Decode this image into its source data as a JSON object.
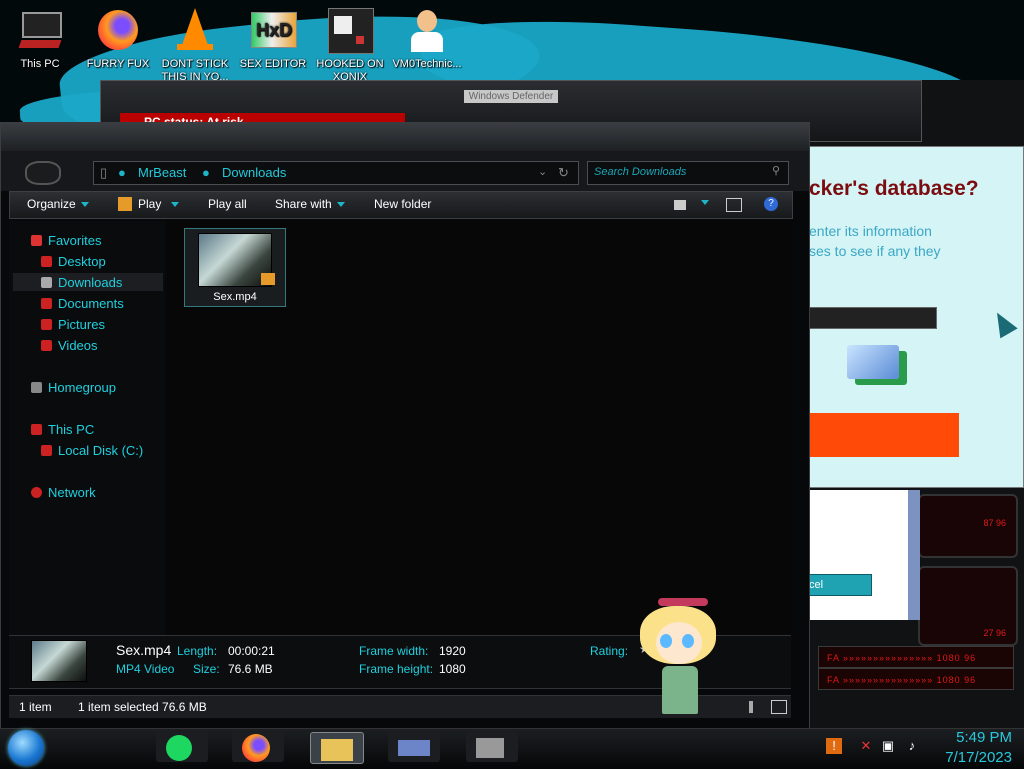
{
  "desktop": {
    "icons": [
      {
        "label": "This PC",
        "icon": "computer-icon"
      },
      {
        "label": "FURRY FUX",
        "icon": "firefox-icon"
      },
      {
        "label": "DONT STICK THIS IN YO...",
        "icon": "vlc-cone-icon"
      },
      {
        "label": "SEX EDITOR",
        "icon": "hxd-editor-icon"
      },
      {
        "label": "HOOKED ON XONIX",
        "icon": "game-icon"
      },
      {
        "label": "VM0Technic...",
        "icon": "doctor-icon"
      }
    ]
  },
  "background_windows": {
    "defender_title": "Windows Defender",
    "defender_status": "PC status: At risk",
    "scam_heading": "cker's database?",
    "scam_line1": "enter its information",
    "scam_line2": "ses to see if any they",
    "scam_cancel": "cel"
  },
  "hud": {
    "bar1": "FA »»»»»»»»»»»»»»» 1080 96",
    "bar2": "FA »»»»»»»»»»»»»»» 1080 96",
    "panel_val1": "87 96",
    "panel_val2": "27 96"
  },
  "explorer": {
    "breadcrumb": [
      "MrBeast",
      "Downloads"
    ],
    "search_placeholder": "Search Downloads",
    "toolbar": {
      "organize": "Organize",
      "play": "Play",
      "play_all": "Play all",
      "share_with": "Share with",
      "new_folder": "New folder"
    },
    "sidebar": {
      "favorites": "Favorites",
      "desktop": "Desktop",
      "downloads": "Downloads",
      "documents": "Documents",
      "pictures": "Pictures",
      "videos": "Videos",
      "homegroup": "Homegroup",
      "this_pc": "This PC",
      "local_disk": "Local Disk (C:)",
      "network": "Network"
    },
    "file": {
      "name": "Sex.mp4"
    },
    "details": {
      "name": "Sex.mp4",
      "type": "MP4 Video",
      "length_label": "Length:",
      "length_value": "00:00:21",
      "size_label": "Size:",
      "size_value": "76.6 MB",
      "frame_width_label": "Frame width:",
      "frame_width_value": "1920",
      "frame_height_label": "Frame height:",
      "frame_height_value": "1080",
      "rating_label": "Rating:"
    },
    "status": {
      "items": "1 item",
      "selected": "1 item selected  76.6 MB"
    }
  },
  "taskbar": {
    "apps": [
      "spotify-icon",
      "firefox-icon",
      "file-explorer-icon",
      "windows-defender-icon",
      "xonix-icon"
    ],
    "tray_icons": [
      "flag-icon",
      "network-icon",
      "speaker-icon"
    ],
    "time": "5:49 PM",
    "date": "7/17/2023"
  },
  "colors": {
    "accent": "#1fd0df",
    "danger": "#b00000",
    "scam_button": "#ff4a08"
  }
}
